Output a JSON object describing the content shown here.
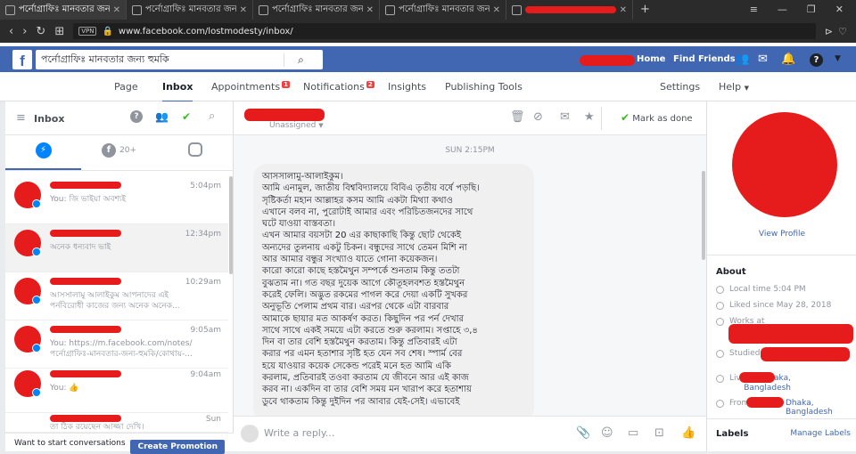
{
  "browser": {
    "tabs": [
      {
        "label": "পর্নোগ্রাফিঃ মানবতার জন্য",
        "active": true
      },
      {
        "label": "পর্নোগ্রাফিঃ মানবতার জন্য",
        "active": false
      },
      {
        "label": "পর্নোগ্রাফিঃ মানবতার জন্য",
        "active": false
      },
      {
        "label": "পর্নোগ্রাফিঃ মানবতার জন্য",
        "active": false
      },
      {
        "label": "",
        "active": false
      }
    ],
    "url": "www.facebook.com/lostmodesty/inbox/",
    "vpn_label": "VPN"
  },
  "fb_header": {
    "logo": "f",
    "search_value": "পর্নোগ্রাফিঃ মানবতার জন্য হুমকি",
    "home_label": "Home",
    "find_friends_label": "Find Friends"
  },
  "page_tabs": {
    "page": "Page",
    "inbox": "Inbox",
    "appointments": "Appointments",
    "appointments_badge": "1",
    "notifications": "Notifications",
    "notifications_badge": "2",
    "insights": "Insights",
    "publishing_tools": "Publishing Tools",
    "settings": "Settings",
    "help": "Help"
  },
  "inbox": {
    "title": "Inbox",
    "instagram_count": "20+",
    "conversations": [
      {
        "time": "5:04pm",
        "snippet": "You: জি ভাইয়া অবশ্যই"
      },
      {
        "time": "12:34pm",
        "snippet": "অনেক ধন্যবাদ ভাই"
      },
      {
        "time": "10:29am",
        "snippet": "আসসালামু আলাইকুম  আপনাদের এই\nপর্নবিরোধী কাজের জন্য অনেক অনেক..."
      },
      {
        "time": "9:05am",
        "snippet": "You: https://m.facebook.com/notes/\nপর্নোগ্রাফিঃ-মানবতার-জন্য-হুমকি/কোথায়-..."
      },
      {
        "time": "9:04am",
        "snippet": "You: 👍"
      },
      {
        "time": "Sun",
        "snippet": "তা ঠিক রয়েছেন আজ্জা দেখি।"
      }
    ],
    "bottom_text": "Want to start conversations",
    "create_promotion": "Create Promotion"
  },
  "conversation": {
    "status": "Unassigned",
    "mark_as_done": "Mark as done",
    "timestamp": "SUN 2:15PM",
    "message": "আসসালামু-আলাইকুম।\nআমি এনামুল, জাতীয় বিশ্ববিদ্যালয়ে বিবিএ তৃতীয় বর্ষে পড়ছি।\nসৃষ্টিকর্তা মহান আল্লাহর কসম আমি একটা মিথ্যা কথাও\nএখানে বলব না, পুরোটাই আমার এবং পরিচিতজনদের সাথে\nঘটে যাওয়া বাস্তবতা।\nএখন আমার বয়সটা 20 এর কাছাকাছি কিন্তু ছোট থেকেই\nঅন্যদের তুলনায় একটু চিকন। বন্ধুদের সাথে তেমন মিশি না\nআর আমার বন্ধুর সংখ্যাও যাতে গোনা কয়েকজন।\nকারো কারো কাছে হস্তমৈথুন সম্পর্কে শুনতাম কিন্তু ততটা\nবুঝতাম না। গত বছর দুয়েক আগে কৌতূহলবশত হস্তমৈথুন\nকরেই ফেলি। অদ্ভুত রকমের পাগল করে দেয়া একটি সুখকর\nঅনুভূতি পেলাম প্রথম বার। এরপর থেকে এটা বারবার\nআমাকে ছায়ার মত আকর্ষণ করত। কিছুদিন পর পর্ন দেখার\nসাথে সাথে একই সময়ে এটা করতে শুরু করলাম। সপ্তাহে ৩,৪\nদিন বা তার বেশি হস্তমৈথুন করতাম। কিন্তু প্রতিবারই এটা\nকরার পর এমন হতাশার সৃষ্টি হত যেন সব শেষ। স্পার্ম বের\nহয়ে যাওয়ার কয়েক সেকেন্ড পরেই মনে হত আমি একি\nকরলাম, প্রতিবারই তওবা করতাম যে জীবনে আর এই কাজ\nকরব না। একদিন বা তার বেশি সময় মন খারাপ করে হতাশায়\nডুবে থাকতাম কিন্তু দুইদিন পর আবার যেই-সেই। এভাবেই",
    "reply_placeholder": "Write a reply..."
  },
  "profile": {
    "view_profile": "View Profile",
    "about_title": "About",
    "local_time": "Local time 5:04 PM",
    "liked_since": "Liked since May 28, 2018",
    "works_at": "Works at",
    "studied": "Studied",
    "lives_in": "Lives in",
    "lives_in_value": "Dhaka,\nBangladesh",
    "from": "From",
    "from_value": "Dhaka, Bangladesh",
    "labels_title": "Labels",
    "manage_labels": "Manage Labels"
  },
  "colors": {
    "facebook_blue": "#4267b2",
    "redaction": "#e61c1c",
    "badge_red": "#fa3e3e",
    "messenger_blue": "#0084ff",
    "done_green": "#42b72a"
  }
}
